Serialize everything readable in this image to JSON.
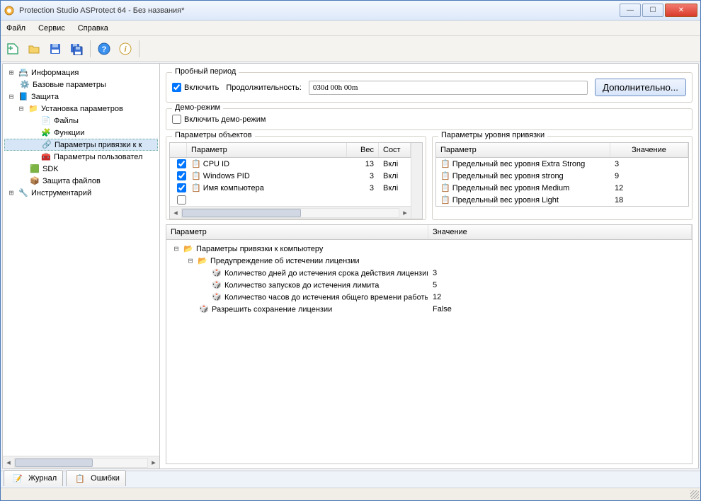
{
  "title": "Protection Studio ASProtect 64 - Без названия*",
  "menu": {
    "file": "Файл",
    "tools": "Сервис",
    "help": "Справка"
  },
  "tree": {
    "info": "Информация",
    "baseparams": "Базовые параметры",
    "protection": "Защита",
    "setparams": "Установка параметров",
    "files": "Файлы",
    "functions": "Функции",
    "bindparams": "Параметры привязки к к",
    "userparams": "Параметры пользовател",
    "sdk": "SDK",
    "protect_files": "Защита файлов",
    "instruments": "Инструментарий"
  },
  "trial": {
    "legend": "Пробный период",
    "enable": "Включить",
    "duration_label": "Продолжительность:",
    "duration": "030d 00h 00m",
    "more": "Дополнительно..."
  },
  "demo": {
    "legend": "Демо-режим",
    "enable": "Включить демо-режим"
  },
  "obj_params": {
    "legend": "Параметры объектов",
    "cols": {
      "param": "Параметр",
      "weight": "Вес",
      "state": "Сост"
    },
    "rows": [
      {
        "name": "CPU ID",
        "weight": "13",
        "state": "Вклі"
      },
      {
        "name": "Windows PID",
        "weight": "3",
        "state": "Вклі"
      },
      {
        "name": "Имя компьютера",
        "weight": "3",
        "state": "Вклі"
      }
    ]
  },
  "lvl_params": {
    "legend": "Параметры уровня привязки",
    "cols": {
      "param": "Параметр",
      "value": "Значение"
    },
    "rows": [
      {
        "name": "Предельный вес уровня Extra Strong",
        "value": "3"
      },
      {
        "name": "Предельный вес уровня strong",
        "value": "9"
      },
      {
        "name": "Предельный вес уровня Medium",
        "value": "12"
      },
      {
        "name": "Предельный вес уровня Light",
        "value": "18"
      }
    ]
  },
  "bottom": {
    "cols": {
      "param": "Параметр",
      "value": "Значение"
    },
    "root": "Параметры привязки к компьютеру",
    "warning": "Предупреждение об истечении лицензии",
    "items": [
      {
        "name": "Количество дней до истечения срока действия лицензии",
        "value": "3"
      },
      {
        "name": "Количество запусков до истечения лимита",
        "value": "5"
      },
      {
        "name": "Количество часов до истечения общего времени работы",
        "value": "12"
      }
    ],
    "allow_save": "Разрешить сохранение лицензии",
    "allow_save_value": "False"
  },
  "tabs": {
    "log": "Журнал",
    "errors": "Ошибки"
  }
}
